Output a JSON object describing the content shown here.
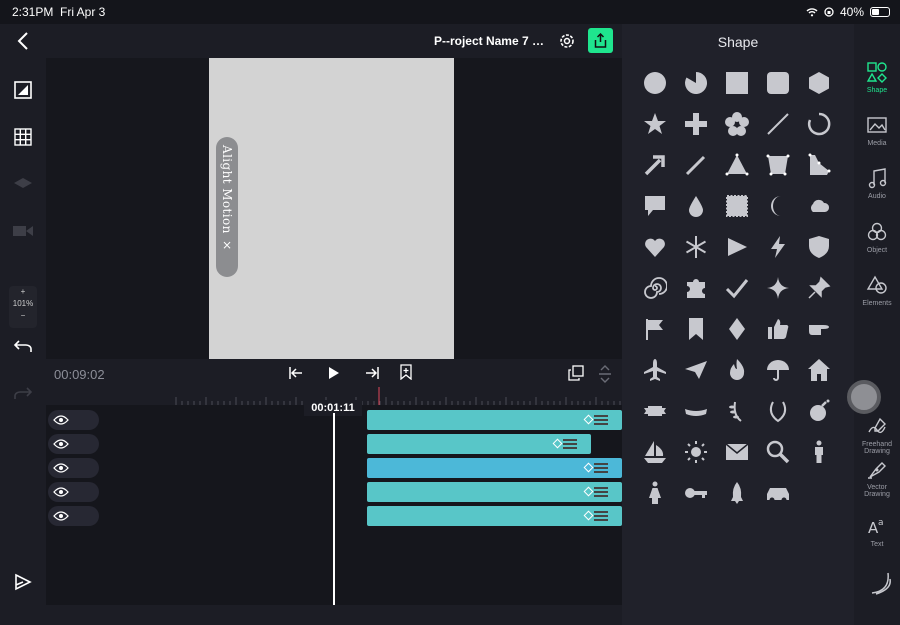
{
  "status_bar": {
    "time": "2:31PM",
    "date": "Fri Apr 3",
    "battery": "40%",
    "wifi_icon": "wifi-icon",
    "battery_icon": "battery-icon"
  },
  "topbar": {
    "project_name": "P--roject Name 7 …",
    "settings_icon": "gear-icon",
    "export_icon": "share-icon",
    "accent": "#1fe58e"
  },
  "left_toolbar": {
    "zoom_in": "+",
    "zoom_level": "101%",
    "zoom_out": "−",
    "icons": [
      "back-chevron-icon",
      "aspect-ratio-icon",
      "grid-icon",
      "layers-icon",
      "camera-icon",
      "undo-icon",
      "redo-icon",
      "play-preview-icon"
    ]
  },
  "preview": {
    "canvas_color": "#d3d3d3",
    "watermark": "Alight Motion ×"
  },
  "playback": {
    "timecode": "00:09:02",
    "playhead_time": "00:01:11"
  },
  "timeline": {
    "tracks": [
      {
        "eye": "eye-icon",
        "color": "#58c6c8",
        "width": 255
      },
      {
        "eye": "eye-icon",
        "color": "#58c6c8",
        "width": 224
      },
      {
        "eye": "eye-icon",
        "color": "#4cb8d8",
        "width": 255
      },
      {
        "eye": "eye-icon",
        "color": "#58c6c8",
        "width": 255
      },
      {
        "eye": "eye-icon",
        "color": "#58c6c8",
        "width": 255
      }
    ]
  },
  "panel": {
    "title": "Shape",
    "shapes": [
      "circle",
      "pie",
      "square",
      "rounded-square",
      "hexagon",
      "star",
      "plus",
      "flower",
      "line",
      "arc",
      "arrow",
      "pencil",
      "triangle",
      "quad",
      "polygon",
      "speech-bubble",
      "drop",
      "stamp",
      "moon",
      "cloud",
      "heart",
      "snowflake",
      "play-triangle",
      "lightning",
      "shield",
      "spiral",
      "puzzle",
      "check",
      "sparkle",
      "pushpin",
      "flag",
      "bookmark",
      "diamond",
      "thumbs-up",
      "pointing-hand",
      "airplane",
      "paper-plane",
      "flame",
      "umbrella",
      "house",
      "ribbon-banner",
      "ribbon-curved",
      "laurel-left",
      "laurel-wreath",
      "bomb",
      "sailboat",
      "sun",
      "envelope",
      "magnifier",
      "man",
      "woman",
      "key",
      "rocket",
      "car"
    ]
  },
  "right_rail": {
    "items": [
      {
        "label": "Shape",
        "icon": "shape-icon",
        "active": true
      },
      {
        "label": "Media",
        "icon": "media-icon"
      },
      {
        "label": "Audio",
        "icon": "music-note-icon"
      },
      {
        "label": "Object",
        "icon": "object-icon"
      },
      {
        "label": "Elements",
        "icon": "elements-icon"
      },
      {
        "label": "Freehand Drawing",
        "icon": "freehand-icon"
      },
      {
        "label": "Vector Drawing",
        "icon": "vector-pen-icon"
      },
      {
        "label": "Text",
        "icon": "text-icon"
      }
    ]
  }
}
